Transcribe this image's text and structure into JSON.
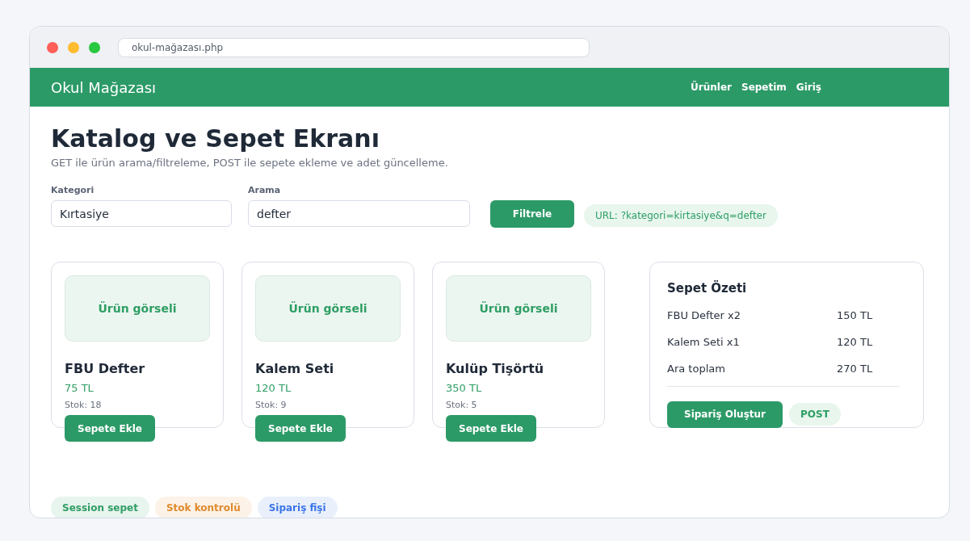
{
  "browser": {
    "address": "okul-mağazası.php"
  },
  "navbar": {
    "brand": "Okul Mağazası",
    "links": [
      "Ürünler",
      "Sepetim",
      "Giriş"
    ]
  },
  "header": {
    "title": "Katalog ve Sepet Ekranı",
    "subtitle": "GET ile ürün arama/filtreleme, POST ile sepete ekleme ve adet güncelleme."
  },
  "filters": {
    "fields": [
      {
        "label": "Kategori",
        "value": "Kırtasiye"
      },
      {
        "label": "Arama",
        "value": "defter"
      }
    ],
    "button": "Filtrele",
    "url_badge": "URL: ?kategori=kirtasiye&q=defter"
  },
  "products": [
    {
      "image_label": "Ürün görseli",
      "name": "FBU Defter",
      "price": "75 TL",
      "stock": "Stok: 18",
      "button": "Sepete Ekle"
    },
    {
      "image_label": "Ürün görseli",
      "name": "Kalem Seti",
      "price": "120 TL",
      "stock": "Stok: 9",
      "button": "Sepete Ekle"
    },
    {
      "image_label": "Ürün görseli",
      "name": "Kulüp Tişörtü",
      "price": "350 TL",
      "stock": "Stok: 5",
      "button": "Sepete Ekle"
    }
  ],
  "cart": {
    "title": "Sepet Özeti",
    "rows": [
      {
        "label": "FBU Defter x2",
        "amount": "150 TL"
      },
      {
        "label": "Kalem Seti x1",
        "amount": "120 TL"
      },
      {
        "label": "Ara toplam",
        "amount": "270 TL"
      }
    ],
    "button": "Sipariş Oluştur",
    "method_badge": "POST"
  },
  "tags": [
    {
      "label": "Session sepet",
      "color": "#2f9e64"
    },
    {
      "label": "Stok kontrolü",
      "color": "#e08a2c"
    },
    {
      "label": "Sipariş fişi",
      "color": "#3b74e8"
    }
  ]
}
